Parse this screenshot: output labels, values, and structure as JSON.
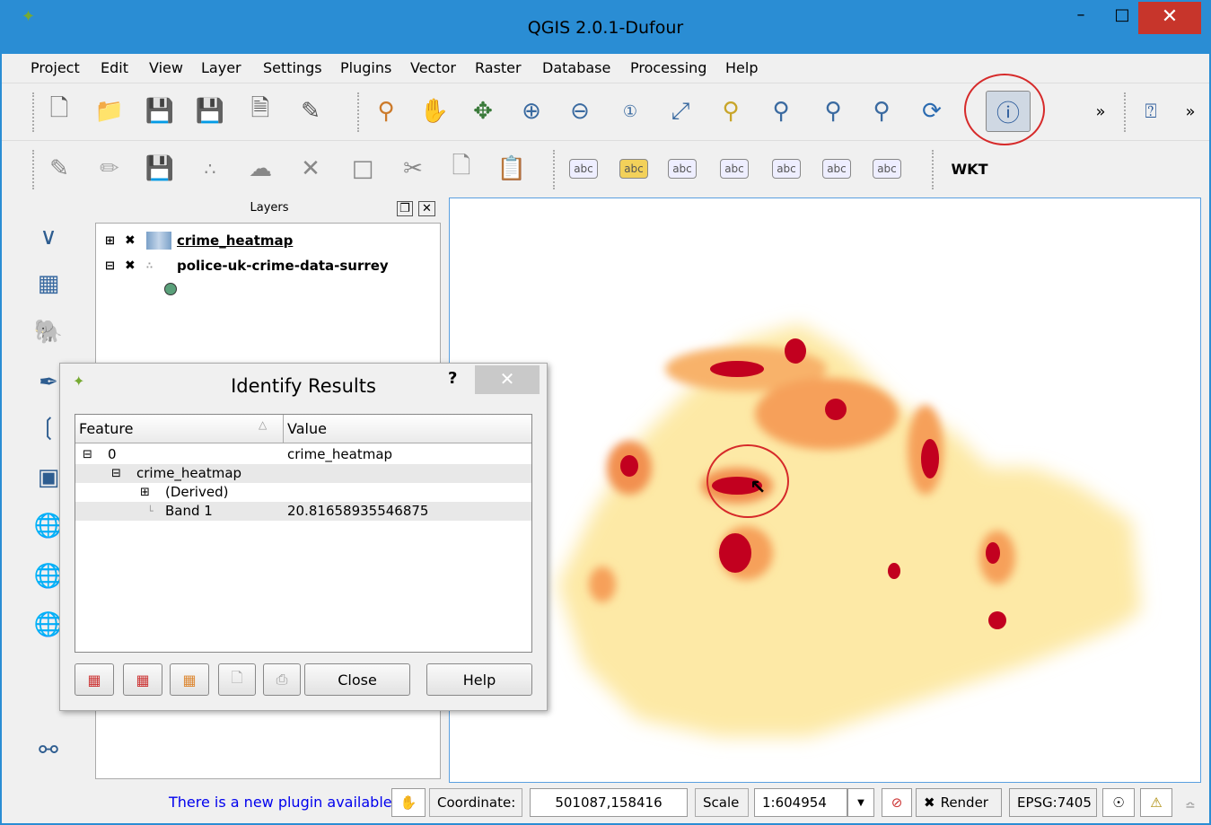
{
  "window": {
    "title": "QGIS 2.0.1-Dufour",
    "minimize": "–",
    "maximize": "□",
    "close": "✕"
  },
  "menu": [
    "Project",
    "Edit",
    "View",
    "Layer",
    "Settings",
    "Plugins",
    "Vector",
    "Raster",
    "Database",
    "Processing",
    "Help"
  ],
  "toolbar1": {
    "icons": [
      "new-project-icon",
      "open-project-icon",
      "save-project-icon",
      "save-as-icon",
      "new-print-composer-icon",
      "composer-manager-icon",
      "pan-to-selection-icon",
      "pan-icon",
      "pan-map-icon",
      "zoom-in-icon",
      "zoom-out-icon",
      "zoom-native-icon",
      "zoom-full-icon",
      "zoom-to-layer-icon",
      "zoom-to-selection-icon",
      "zoom-last-icon",
      "zoom-next-icon",
      "refresh-icon",
      "identify-features-icon"
    ],
    "overflow": "»",
    "help_overflow": "»"
  },
  "toolbar2": {
    "labels": [
      "abc",
      "abc",
      "abc",
      "abc",
      "abc",
      "abc",
      "abc"
    ],
    "wkt": "WKT"
  },
  "layers_panel": {
    "title": "Layers",
    "items": [
      {
        "name": "crime_heatmap",
        "checked": true,
        "expander": "⊞"
      },
      {
        "name": "police-uk-crime-data-surrey",
        "checked": true,
        "expander": "⊟"
      }
    ]
  },
  "identify_dialog": {
    "title": "Identify Results",
    "help_mark": "?",
    "columns": [
      "Feature",
      "Value"
    ],
    "rows": [
      {
        "indent": 0,
        "expander": "⊟",
        "feature": "0",
        "value": "crime_heatmap"
      },
      {
        "indent": 1,
        "expander": "⊟",
        "feature": "crime_heatmap",
        "value": ""
      },
      {
        "indent": 2,
        "expander": "⊞",
        "feature": "(Derived)",
        "value": ""
      },
      {
        "indent": 2,
        "expander": "",
        "feature": "Band 1",
        "value": "20.81658935546875"
      }
    ],
    "buttons": {
      "close": "Close",
      "help": "Help"
    }
  },
  "status": {
    "plugin_link": "There is a new plugin available",
    "coordinate_label": "Coordinate:",
    "coordinate_value": "501087,158416",
    "scale_label": "Scale",
    "scale_value": "1:604954",
    "render_label": "Render",
    "crs": "EPSG:7405"
  },
  "colors": {
    "accent": "#2a8dd4",
    "close": "#c7352b",
    "annotation": "#d62a2a",
    "heat_low": "#fde9a6",
    "heat_high": "#c2001f"
  }
}
